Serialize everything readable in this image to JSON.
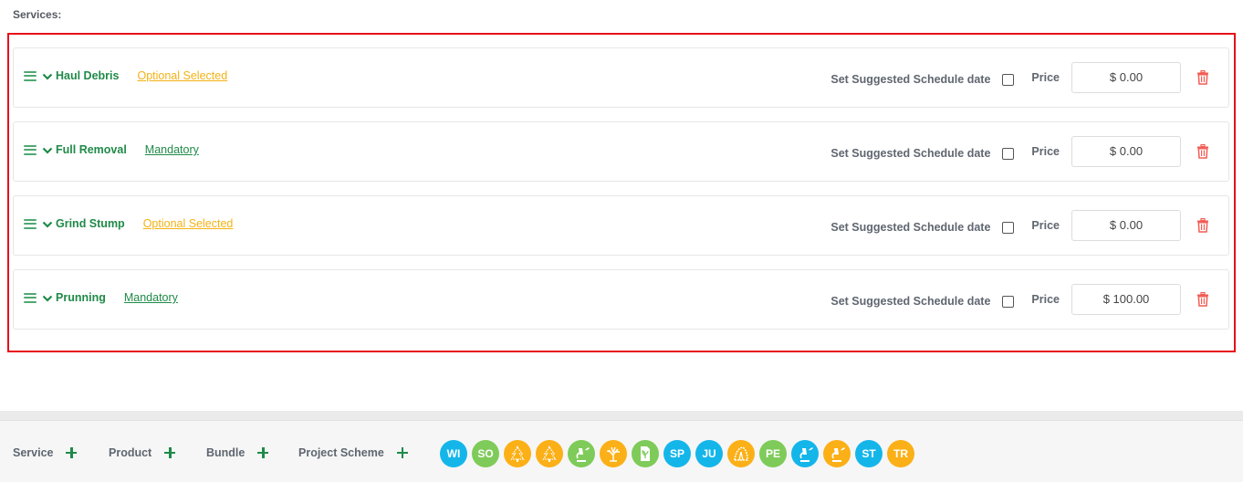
{
  "section_title": "Services:",
  "colors": {
    "green": "#1f8a48",
    "optional": "#f4b214",
    "highlight": "#e8101a",
    "trash": "#f25c54",
    "blue": "#14b6ea",
    "lightgreen": "#7fcb5a",
    "orange": "#fbb017"
  },
  "labels": {
    "schedule": "Set Suggested Schedule date",
    "price": "Price"
  },
  "services": [
    {
      "name": "Haul Debris",
      "status": "Optional Selected",
      "status_type": "optional",
      "schedule_checked": false,
      "price": "$ 0.00"
    },
    {
      "name": "Full Removal",
      "status": "Mandatory",
      "status_type": "mandatory",
      "schedule_checked": false,
      "price": "$ 0.00"
    },
    {
      "name": "Grind Stump",
      "status": "Optional Selected",
      "status_type": "optional",
      "schedule_checked": false,
      "price": "$ 0.00"
    },
    {
      "name": "Prunning",
      "status": "Mandatory",
      "status_type": "mandatory",
      "schedule_checked": false,
      "price": "$ 100.00"
    }
  ],
  "add_buttons": [
    {
      "label": "Service"
    },
    {
      "label": "Product"
    },
    {
      "label": "Bundle"
    },
    {
      "label": "Project Scheme"
    }
  ],
  "season_badges": [
    {
      "text": "WI",
      "color": "blue",
      "icon": "text"
    },
    {
      "text": "SO",
      "color": "lightgreen",
      "icon": "text"
    },
    {
      "text": "",
      "color": "orange",
      "icon": "xmas-tree-icon"
    },
    {
      "text": "",
      "color": "orange",
      "icon": "xmas-tree-icon"
    },
    {
      "text": "",
      "color": "lightgreen",
      "icon": "microscope-icon"
    },
    {
      "text": "",
      "color": "orange",
      "icon": "tree-icon"
    },
    {
      "text": "",
      "color": "lightgreen",
      "icon": "document-leaf-icon"
    },
    {
      "text": "SP",
      "color": "blue",
      "icon": "text"
    },
    {
      "text": "JU",
      "color": "blue",
      "icon": "text"
    },
    {
      "text": "",
      "color": "orange",
      "icon": "shrub-icon"
    },
    {
      "text": "PE",
      "color": "lightgreen",
      "icon": "text"
    },
    {
      "text": "",
      "color": "blue",
      "icon": "microscope-icon"
    },
    {
      "text": "",
      "color": "orange",
      "icon": "microscope-icon"
    },
    {
      "text": "ST",
      "color": "blue",
      "icon": "text"
    },
    {
      "text": "TR",
      "color": "orange",
      "icon": "text"
    }
  ]
}
